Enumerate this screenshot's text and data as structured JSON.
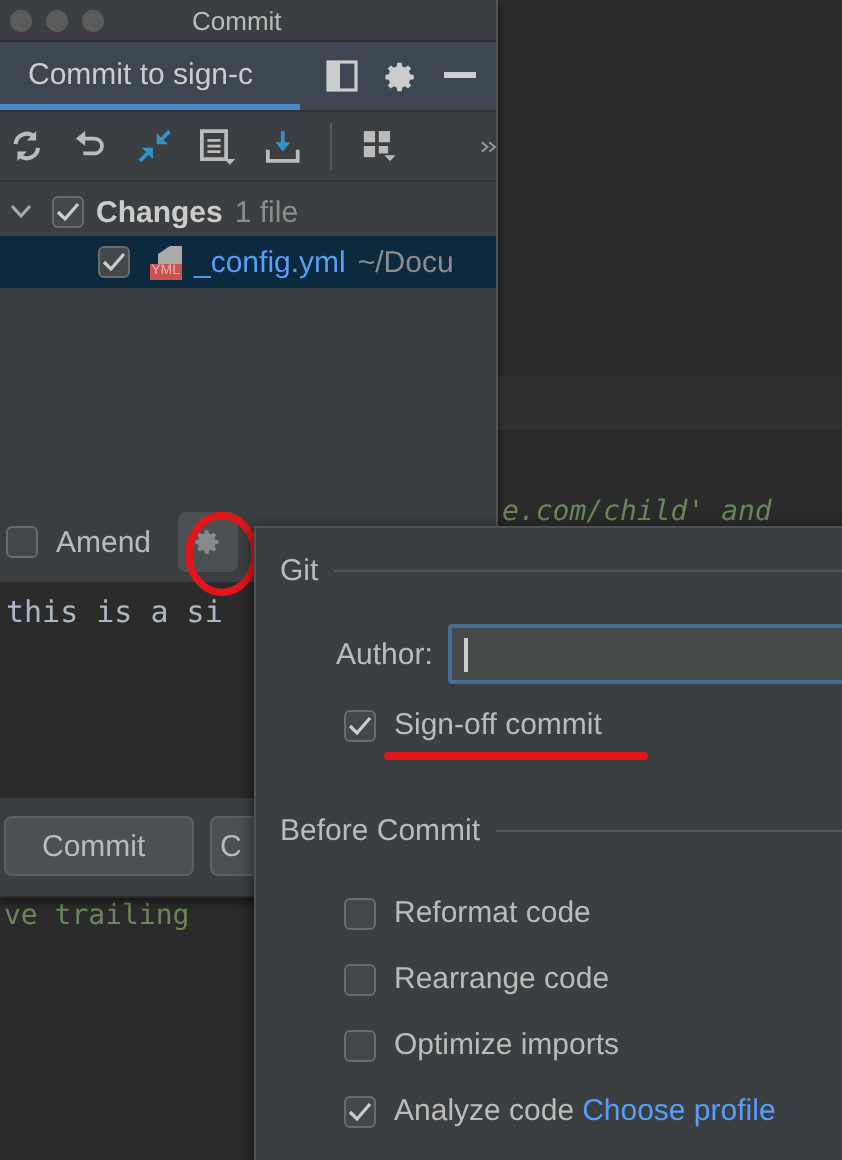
{
  "window": {
    "title": "Commit"
  },
  "tab": {
    "label": "Commit to sign-c",
    "selected": true
  },
  "changes": {
    "label": "Changes",
    "count": "1 file",
    "checked": true,
    "expanded": true,
    "files": [
      {
        "name": "_config.yml",
        "path": "~/Docu",
        "badge": "YML",
        "checked": true,
        "selected": true
      }
    ]
  },
  "amend": {
    "label": "Amend",
    "checked": false
  },
  "message": "this is a si",
  "buttons": [
    "Commit",
    "C"
  ],
  "editor_lines": [
    "e.com/child' and",
    "ve trailing"
  ],
  "popup": {
    "git_title": "Git",
    "author_label": "Author:",
    "signoff": {
      "label": "Sign-off commit",
      "checked": true
    },
    "before_title": "Before Commit",
    "options": [
      {
        "label": "Reformat code",
        "checked": false
      },
      {
        "label": "Rearrange code",
        "checked": false
      },
      {
        "label": "Optimize imports",
        "checked": false
      },
      {
        "label": "Analyze code",
        "checked": true,
        "link": "Choose profile"
      }
    ]
  }
}
